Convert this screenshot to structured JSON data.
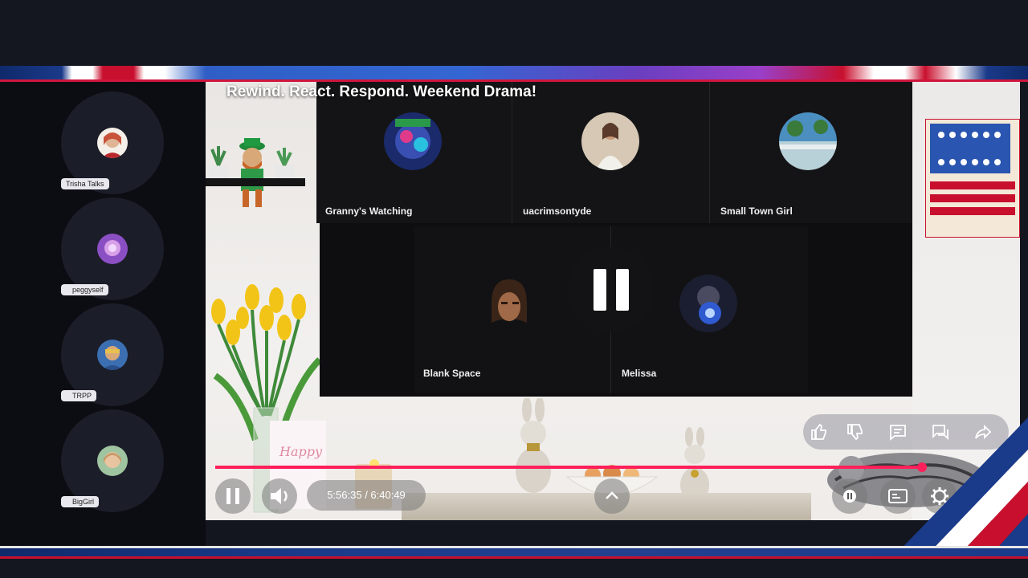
{
  "stream": {
    "title": "Rewind. React. Respond. Weekend Drama!"
  },
  "sidebar": {
    "listeners": [
      {
        "name": "Trisha Talks",
        "avatar_color": "#c8523a"
      },
      {
        "name": "peggyself",
        "avatar_color": "#8b4fc4"
      },
      {
        "name": "TRPP",
        "avatar_color": "#3b6fb2"
      },
      {
        "name": "BigGirl",
        "avatar_color": "#c89a6a"
      }
    ]
  },
  "speakers": {
    "row1": [
      {
        "name": "Granny's Watching",
        "avatar_color": "#3a4fb2"
      },
      {
        "name": "uacrimsontyde",
        "avatar_color": "#c9b59a"
      },
      {
        "name": "Small Town Girl",
        "avatar_color": "#4a8fc0"
      }
    ],
    "row2": [
      {
        "name": "Blank Space",
        "avatar_color": "#8a5a3a"
      },
      {
        "name": "Melissa",
        "avatar_color": "#2f5ad0"
      }
    ]
  },
  "player": {
    "time": "5:56:35 / 6:40:49",
    "progress": 0.89,
    "state": "paused",
    "accent": "#ff1f5a"
  },
  "icons": {
    "pause": "pause-icon",
    "volume": "volume-icon",
    "expand": "chevron-up-icon",
    "like": "thumbs-up-icon",
    "dislike": "thumbs-down-icon",
    "comment": "comment-icon",
    "chat": "chat-icon",
    "share": "share-icon",
    "settings": "gear-icon",
    "captions": "captions-icon"
  }
}
